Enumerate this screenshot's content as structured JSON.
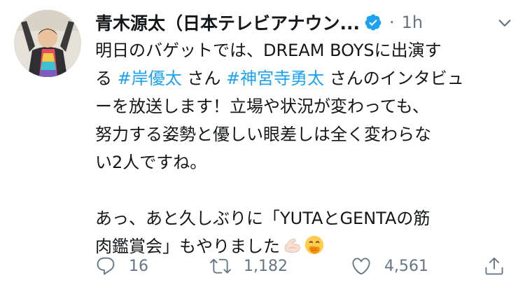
{
  "tweet": {
    "author_name": "青木源太（日本テレビアナウン...",
    "separator": "·",
    "timestamp": "1h",
    "body": {
      "line1": "明日のバゲットでは、DREAM BOYSに出演す",
      "line2_prefix": "る ",
      "hashtag1": "#岸優太",
      "line2_mid": " さん ",
      "hashtag2": "#神宮寺勇太",
      "line2_suffix": " さんのインタビュ",
      "line3": "ーを放送します！立場や状況が変わっても、",
      "line4": "努力する姿勢と優しい眼差しは全く変わらな",
      "line5": "い2人ですね。",
      "line6": "あっ、あと久しぶりに「YUTAとGENTAの筋",
      "line7": "肉鑑賞会」もやりました"
    },
    "emojis": [
      "flexed-biceps-light-skin-emoji",
      "face-with-hand-over-mouth-emoji"
    ],
    "stats": {
      "replies": "16",
      "retweets": "1,182",
      "likes": "4,561"
    }
  },
  "colors": {
    "text": "#14171a",
    "secondary": "#657786",
    "link": "#1da1f2"
  }
}
